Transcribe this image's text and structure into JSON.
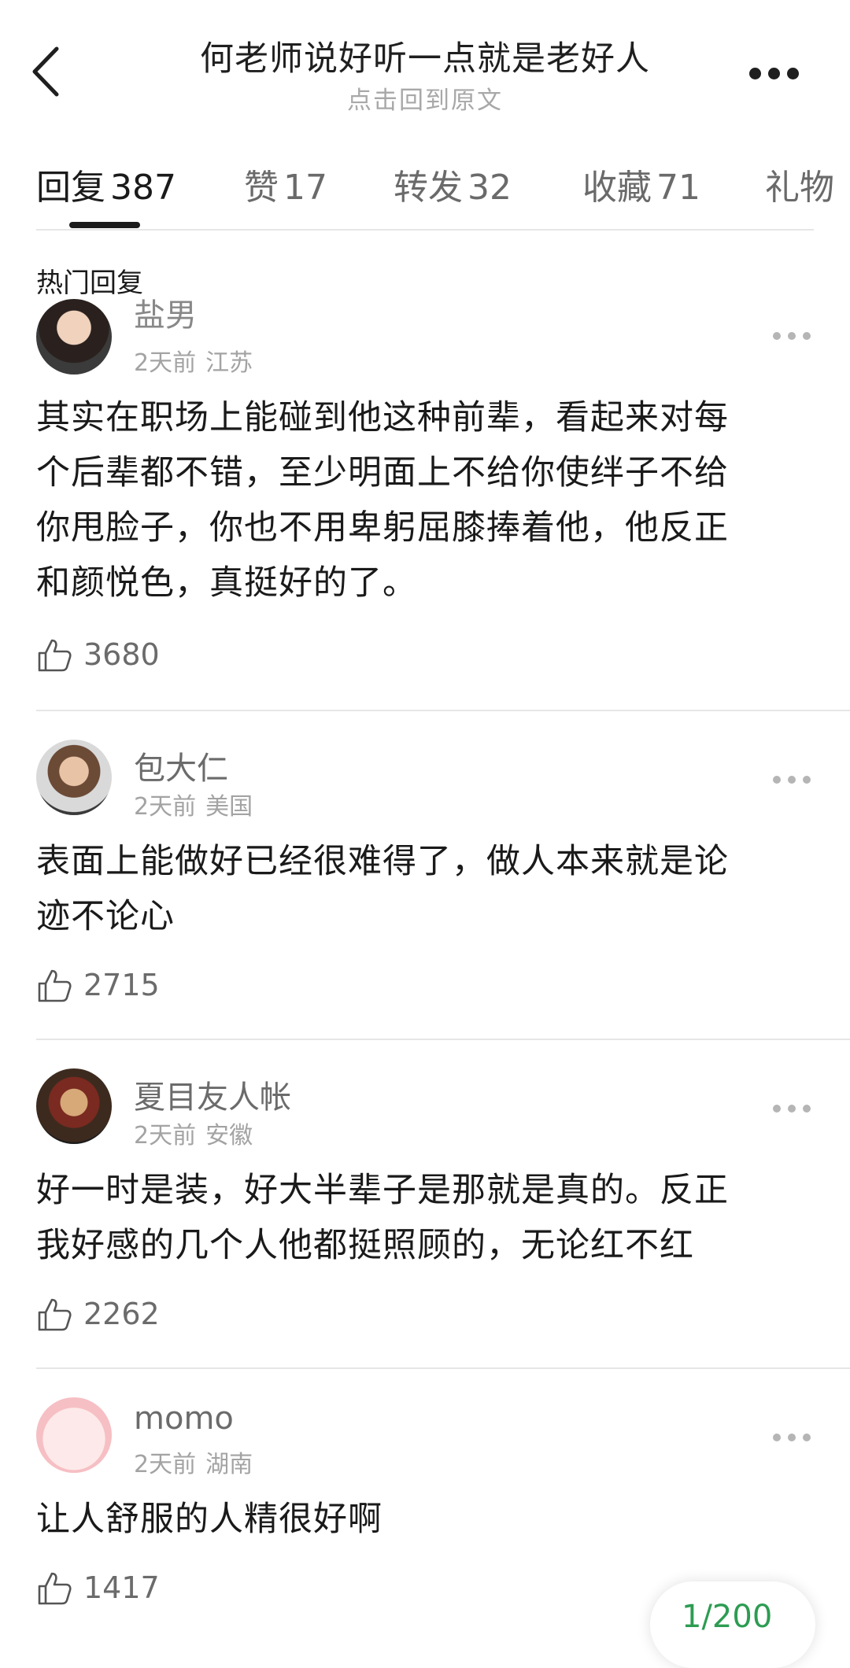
{
  "header": {
    "title": "何老师说好听一点就是老好人",
    "subtitle": "点击回到原文"
  },
  "tabs": [
    {
      "label": "回复",
      "count": "387"
    },
    {
      "label": "赞",
      "count": "17"
    },
    {
      "label": "转发",
      "count": "32"
    },
    {
      "label": "收藏",
      "count": "71"
    },
    {
      "label": "礼物",
      "count": ""
    }
  ],
  "section_label": "热门回复",
  "comments": [
    {
      "username": "盐男",
      "time": "2天前",
      "location": "江苏",
      "lines": [
        "其实在职场上能碰到他这种前辈，看起来对每",
        "个后辈都不错，至少明面上不给你使绊子不给",
        "你甩脸子，你也不用卑躬屈膝捧着他，他反正",
        "和颜悦色，真挺好的了。"
      ],
      "likes": "3680"
    },
    {
      "username": "包大仁",
      "time": "2天前",
      "location": "美国",
      "lines": [
        "表面上能做好已经很难得了，做人本来就是论",
        "迹不论心"
      ],
      "likes": "2715"
    },
    {
      "username": "夏目友人帐",
      "time": "2天前",
      "location": "安徽",
      "lines": [
        "好一时是装，好大半辈子是那就是真的。反正",
        "我好感的几个人他都挺照顾的，无论红不红"
      ],
      "likes": "2262"
    },
    {
      "username": "momo",
      "time": "2天前",
      "location": "湖南",
      "lines": [
        "让人舒服的人精很好啊"
      ],
      "likes": "1417"
    }
  ],
  "page_indicator": "1/200",
  "colors": {
    "accent_green": "#2c9c52",
    "meta_gray": "#a3a3a3",
    "divider": "#e6e6e6"
  },
  "icons": [
    "back-icon",
    "more-icon",
    "like-icon",
    "comment-more-icon"
  ]
}
